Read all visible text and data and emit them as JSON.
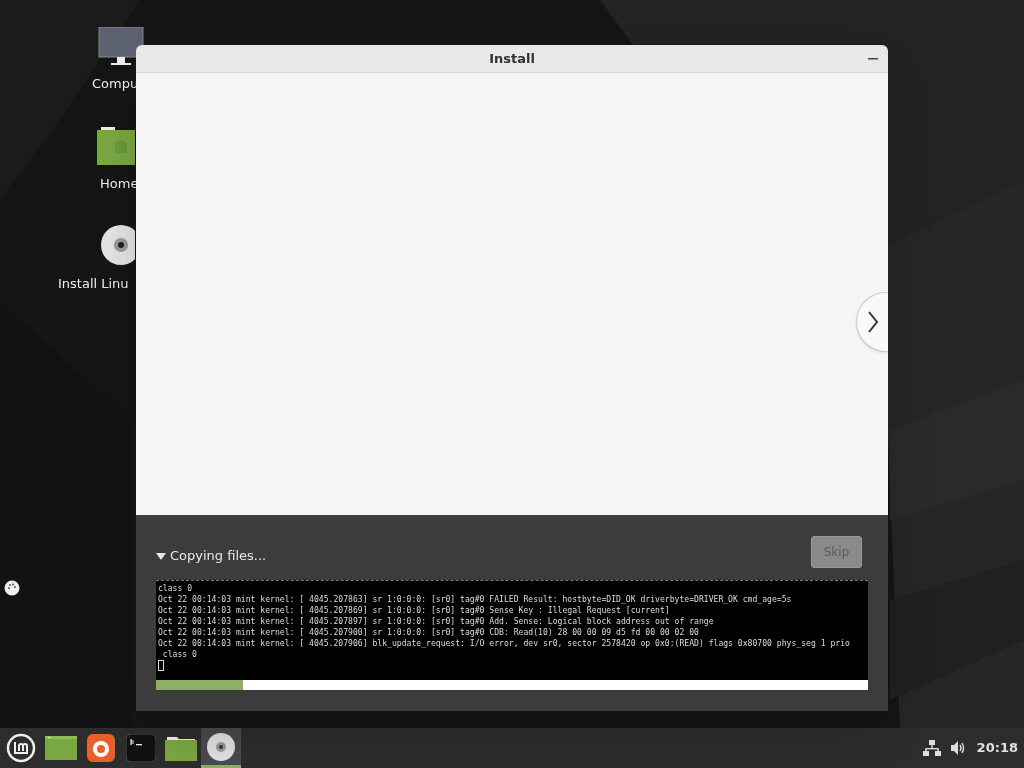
{
  "desktop_icons": [
    {
      "kind": "computer",
      "label": "Compu"
    },
    {
      "kind": "home",
      "label": "Home"
    },
    {
      "kind": "disc",
      "label": "Install Linu"
    }
  ],
  "window": {
    "title": "Install",
    "expander": {
      "label": "Copying files...",
      "expanded": true
    },
    "skip_button": {
      "label": "Skip",
      "disabled": true
    },
    "terminal_lines": [
      "class 0",
      "Oct 22 00:14:03 mint kernel: [ 4045.207863] sr 1:0:0:0: [sr0] tag#0 FAILED Result: hostbyte=DID_OK driverbyte=DRIVER_OK cmd_age=5s",
      "Oct 22 00:14:03 mint kernel: [ 4045.207869] sr 1:0:0:0: [sr0] tag#0 Sense Key : Illegal Request [current]",
      "Oct 22 00:14:03 mint kernel: [ 4045.207897] sr 1:0:0:0: [sr0] tag#0 Add. Sense: Logical block address out of range",
      "Oct 22 00:14:03 mint kernel: [ 4045.207900] sr 1:0:0:0: [sr0] tag#0 CDB: Read(10) 28 00 00 09 d5 fd 00 00 02 00",
      "Oct 22 00:14:03 mint kernel: [ 4045.207906] blk_update_request: I/O error, dev sr0, sector 2578420 op 0x0:(READ) flags 0x80700 phys_seg 1 prio",
      " class 0"
    ],
    "progress": {
      "level": 0.122
    }
  },
  "taskbar": {
    "items": [
      {
        "kind": "menu",
        "selected": false
      },
      {
        "kind": "desktop",
        "selected": false
      },
      {
        "kind": "browser",
        "selected": false
      },
      {
        "kind": "terminal",
        "selected": false
      },
      {
        "kind": "folder",
        "selected": false
      },
      {
        "kind": "disc",
        "selected": true
      }
    ],
    "clock": "20:18"
  }
}
